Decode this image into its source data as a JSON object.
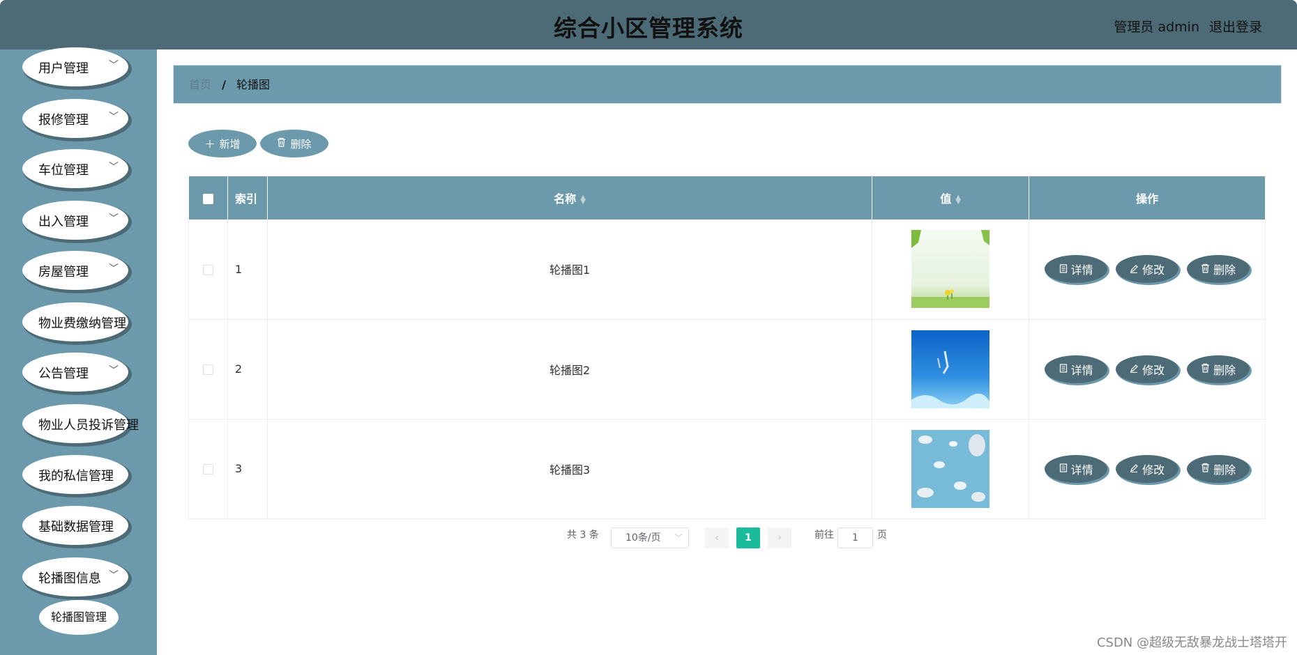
{
  "header": {
    "title": "综合小区管理系统",
    "user": "管理员 admin",
    "logout": "退出登录"
  },
  "sidebar": {
    "items": [
      {
        "label": "用户管理",
        "chevron": true
      },
      {
        "label": "报修管理",
        "chevron": true
      },
      {
        "label": "车位管理",
        "chevron": true
      },
      {
        "label": "出入管理",
        "chevron": true
      },
      {
        "label": "房屋管理",
        "chevron": true
      },
      {
        "label": "物业费缴纳管理",
        "chevron": false
      },
      {
        "label": "公告管理",
        "chevron": true
      },
      {
        "label": "物业人员投诉管理",
        "chevron": false
      },
      {
        "label": "我的私信管理",
        "chevron": false
      },
      {
        "label": "基础数据管理",
        "chevron": false
      },
      {
        "label": "轮播图信息",
        "chevron": true
      }
    ],
    "sub_item": "轮播图管理"
  },
  "breadcrumb": {
    "home": "首页",
    "separator": "/",
    "current": "轮播图"
  },
  "actions": {
    "add": "新增",
    "delete": "删除"
  },
  "table": {
    "headers": {
      "index": "索引",
      "name": "名称",
      "value": "值",
      "ops": "操作"
    },
    "rows": [
      {
        "index": "1",
        "name": "轮播图1",
        "image": "meadow-flower-image"
      },
      {
        "index": "2",
        "name": "轮播图2",
        "image": "blue-sky-bird-image"
      },
      {
        "index": "3",
        "name": "轮播图3",
        "image": "sky-clouds-image"
      }
    ],
    "ops": {
      "detail": "详情",
      "edit": "修改",
      "delete": "删除"
    }
  },
  "pagination": {
    "total": "共 3 条",
    "page_size": "10条/页",
    "current_page": "1",
    "goto_label": "前往",
    "goto_value": "1",
    "page_suffix": "页"
  },
  "watermark": "CSDN @超级无敌暴龙战士塔塔开",
  "colors": {
    "header": "#4d6b76",
    "sidebar": "#6c9aac",
    "accent": "#1abc9c"
  }
}
